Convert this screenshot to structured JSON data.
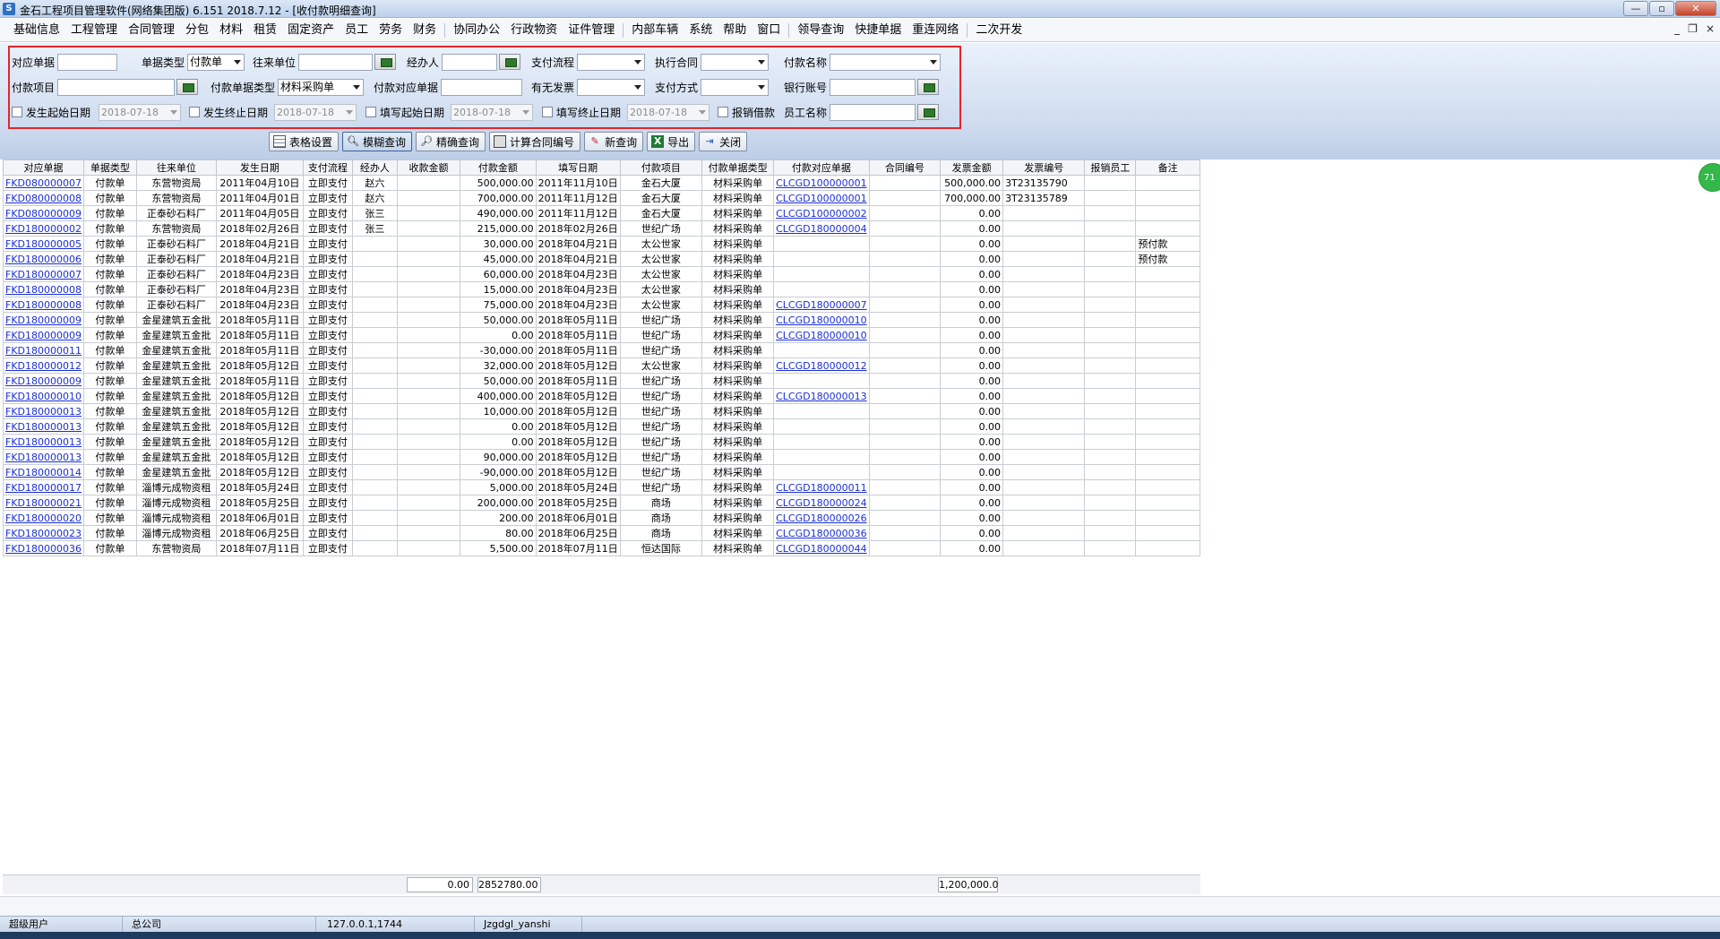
{
  "window": {
    "title": "金石工程项目管理软件(网络集团版) 6.151  2018.7.12 - [收付款明细查询]",
    "min": "—",
    "max": "▫",
    "close": "✕"
  },
  "menu": [
    "基础信息",
    "工程管理",
    "合同管理",
    "分包",
    "材料",
    "租赁",
    "固定资产",
    "员工",
    "劳务",
    "财务",
    "协同办公",
    "行政物资",
    "证件管理",
    "内部车辆",
    "系统",
    "帮助",
    "窗口",
    "领导查询",
    "快捷单据",
    "重连网络",
    "二次开发"
  ],
  "mdi": {
    "min": "_",
    "restore": "❐",
    "close": "×"
  },
  "query": {
    "l_doc": "对应单据",
    "l_doctype": "单据类型",
    "doctype_value": "付款单",
    "l_partner": "往来单位",
    "l_handler": "经办人",
    "l_flow": "支付流程",
    "l_contract": "执行合同",
    "l_payname": "付款名称",
    "l_payitem": "付款项目",
    "l_paydoctype": "付款单据类型",
    "paydoctype_value": "材料采购单",
    "l_paydoc": "付款对应单据",
    "l_invoice": "有无发票",
    "l_paymethod": "支付方式",
    "l_bank": "银行账号",
    "l_occ_start": "发生起始日期",
    "occ_start": "2018-07-18",
    "l_occ_end": "发生终止日期",
    "occ_end": "2018-07-18",
    "l_fill_start": "填写起始日期",
    "fill_start": "2018-07-18",
    "l_fill_end": "填写终止日期",
    "fill_end": "2018-07-18",
    "l_reimb": "报销借款",
    "l_staff": "员工名称"
  },
  "toolbar": {
    "table_settings": "表格设置",
    "fuzzy": "模糊查询",
    "exact": "精确查询",
    "calc_contract": "计算合同编号",
    "new_query": "新查询",
    "export": "导出",
    "close": "关闭"
  },
  "side_badge": "71",
  "grid": {
    "columns": [
      "对应单据",
      "单据类型",
      "往来单位",
      "发生日期",
      "支付流程",
      "经办人",
      "收款金额",
      "付款金额",
      "填写日期",
      "付款项目",
      "付款单据类型",
      "付款对应单据",
      "合同编号",
      "发票金额",
      "发票编号",
      "报销员工",
      "备注"
    ],
    "rows": [
      [
        "FKD080000007",
        "付款单",
        "东营物资局",
        "2011年04月10日",
        "立即支付",
        "赵六",
        "",
        "500,000.00",
        "2011年11月10日",
        "金石大厦",
        "材料采购单",
        "CLCGD100000001",
        "",
        "500,000.00",
        "3T23135790",
        "",
        ""
      ],
      [
        "FKD080000008",
        "付款单",
        "东营物资局",
        "2011年04月01日",
        "立即支付",
        "赵六",
        "",
        "700,000.00",
        "2011年11月12日",
        "金石大厦",
        "材料采购单",
        "CLCGD100000001",
        "",
        "700,000.00",
        "3T23135789",
        "",
        ""
      ],
      [
        "FKD080000009",
        "付款单",
        "正泰砂石料厂",
        "2011年04月05日",
        "立即支付",
        "张三",
        "",
        "490,000.00",
        "2011年11月12日",
        "金石大厦",
        "材料采购单",
        "CLCGD100000002",
        "",
        "0.00",
        "",
        "",
        ""
      ],
      [
        "FKD180000002",
        "付款单",
        "东营物资局",
        "2018年02月26日",
        "立即支付",
        "张三",
        "",
        "215,000.00",
        "2018年02月26日",
        "世纪广场",
        "材料采购单",
        "CLCGD180000004",
        "",
        "0.00",
        "",
        "",
        ""
      ],
      [
        "FKD180000005",
        "付款单",
        "正泰砂石料厂",
        "2018年04月21日",
        "立即支付",
        "",
        "",
        "30,000.00",
        "2018年04月21日",
        "太公世家",
        "材料采购单",
        "",
        "",
        "0.00",
        "",
        "",
        "预付款"
      ],
      [
        "FKD180000006",
        "付款单",
        "正泰砂石料厂",
        "2018年04月21日",
        "立即支付",
        "",
        "",
        "45,000.00",
        "2018年04月21日",
        "太公世家",
        "材料采购单",
        "",
        "",
        "0.00",
        "",
        "",
        "预付款"
      ],
      [
        "FKD180000007",
        "付款单",
        "正泰砂石料厂",
        "2018年04月23日",
        "立即支付",
        "",
        "",
        "60,000.00",
        "2018年04月23日",
        "太公世家",
        "材料采购单",
        "",
        "",
        "0.00",
        "",
        "",
        ""
      ],
      [
        "FKD180000008",
        "付款单",
        "正泰砂石料厂",
        "2018年04月23日",
        "立即支付",
        "",
        "",
        "15,000.00",
        "2018年04月23日",
        "太公世家",
        "材料采购单",
        "",
        "",
        "0.00",
        "",
        "",
        ""
      ],
      [
        "FKD180000008",
        "付款单",
        "正泰砂石料厂",
        "2018年04月23日",
        "立即支付",
        "",
        "",
        "75,000.00",
        "2018年04月23日",
        "太公世家",
        "材料采购单",
        "CLCGD180000007",
        "",
        "0.00",
        "",
        "",
        ""
      ],
      [
        "FKD180000009",
        "付款单",
        "金星建筑五金批",
        "2018年05月11日",
        "立即支付",
        "",
        "",
        "50,000.00",
        "2018年05月11日",
        "世纪广场",
        "材料采购单",
        "CLCGD180000010",
        "",
        "0.00",
        "",
        "",
        ""
      ],
      [
        "FKD180000009",
        "付款单",
        "金星建筑五金批",
        "2018年05月11日",
        "立即支付",
        "",
        "",
        "0.00",
        "2018年05月11日",
        "世纪广场",
        "材料采购单",
        "CLCGD180000010",
        "",
        "0.00",
        "",
        "",
        ""
      ],
      [
        "FKD180000011",
        "付款单",
        "金星建筑五金批",
        "2018年05月11日",
        "立即支付",
        "",
        "",
        "-30,000.00",
        "2018年05月11日",
        "世纪广场",
        "材料采购单",
        "",
        "",
        "0.00",
        "",
        "",
        ""
      ],
      [
        "FKD180000012",
        "付款单",
        "金星建筑五金批",
        "2018年05月12日",
        "立即支付",
        "",
        "",
        "32,000.00",
        "2018年05月12日",
        "太公世家",
        "材料采购单",
        "CLCGD180000012",
        "",
        "0.00",
        "",
        "",
        ""
      ],
      [
        "FKD180000009",
        "付款单",
        "金星建筑五金批",
        "2018年05月11日",
        "立即支付",
        "",
        "",
        "50,000.00",
        "2018年05月11日",
        "世纪广场",
        "材料采购单",
        "",
        "",
        "0.00",
        "",
        "",
        ""
      ],
      [
        "FKD180000010",
        "付款单",
        "金星建筑五金批",
        "2018年05月12日",
        "立即支付",
        "",
        "",
        "400,000.00",
        "2018年05月12日",
        "世纪广场",
        "材料采购单",
        "CLCGD180000013",
        "",
        "0.00",
        "",
        "",
        ""
      ],
      [
        "FKD180000013",
        "付款单",
        "金星建筑五金批",
        "2018年05月12日",
        "立即支付",
        "",
        "",
        "10,000.00",
        "2018年05月12日",
        "世纪广场",
        "材料采购单",
        "",
        "",
        "0.00",
        "",
        "",
        ""
      ],
      [
        "FKD180000013",
        "付款单",
        "金星建筑五金批",
        "2018年05月12日",
        "立即支付",
        "",
        "",
        "0.00",
        "2018年05月12日",
        "世纪广场",
        "材料采购单",
        "",
        "",
        "0.00",
        "",
        "",
        ""
      ],
      [
        "FKD180000013",
        "付款单",
        "金星建筑五金批",
        "2018年05月12日",
        "立即支付",
        "",
        "",
        "0.00",
        "2018年05月12日",
        "世纪广场",
        "材料采购单",
        "",
        "",
        "0.00",
        "",
        "",
        ""
      ],
      [
        "FKD180000013",
        "付款单",
        "金星建筑五金批",
        "2018年05月12日",
        "立即支付",
        "",
        "",
        "90,000.00",
        "2018年05月12日",
        "世纪广场",
        "材料采购单",
        "",
        "",
        "0.00",
        "",
        "",
        ""
      ],
      [
        "FKD180000014",
        "付款单",
        "金星建筑五金批",
        "2018年05月12日",
        "立即支付",
        "",
        "",
        "-90,000.00",
        "2018年05月12日",
        "世纪广场",
        "材料采购单",
        "",
        "",
        "0.00",
        "",
        "",
        ""
      ],
      [
        "FKD180000017",
        "付款单",
        "淄博元成物资租",
        "2018年05月24日",
        "立即支付",
        "",
        "",
        "5,000.00",
        "2018年05月24日",
        "世纪广场",
        "材料采购单",
        "CLCGD180000011",
        "",
        "0.00",
        "",
        "",
        ""
      ],
      [
        "FKD180000021",
        "付款单",
        "淄博元成物资租",
        "2018年05月25日",
        "立即支付",
        "",
        "",
        "200,000.00",
        "2018年05月25日",
        "商场",
        "材料采购单",
        "CLCGD180000024",
        "",
        "0.00",
        "",
        "",
        ""
      ],
      [
        "FKD180000020",
        "付款单",
        "淄博元成物资租",
        "2018年06月01日",
        "立即支付",
        "",
        "",
        "200.00",
        "2018年06月01日",
        "商场",
        "材料采购单",
        "CLCGD180000026",
        "",
        "0.00",
        "",
        "",
        ""
      ],
      [
        "FKD180000023",
        "付款单",
        "淄博元成物资租",
        "2018年06月25日",
        "立即支付",
        "",
        "",
        "80.00",
        "2018年06月25日",
        "商场",
        "材料采购单",
        "CLCGD180000036",
        "",
        "0.00",
        "",
        "",
        ""
      ],
      [
        "FKD180000036",
        "付款单",
        "东营物资局",
        "2018年07月11日",
        "立即支付",
        "",
        "",
        "5,500.00",
        "2018年07月11日",
        "恒达国际",
        "材料采购单",
        "CLCGD180000044",
        "",
        "0.00",
        "",
        "",
        ""
      ]
    ]
  },
  "totals": {
    "receipt": "0.00",
    "payment": "2852780.00",
    "invoice": "1,200,000.0"
  },
  "status": {
    "user": "超级用户",
    "company": "总公司",
    "address": "127.0.0.1,1744",
    "db": "Jzgdgl_yanshi"
  }
}
